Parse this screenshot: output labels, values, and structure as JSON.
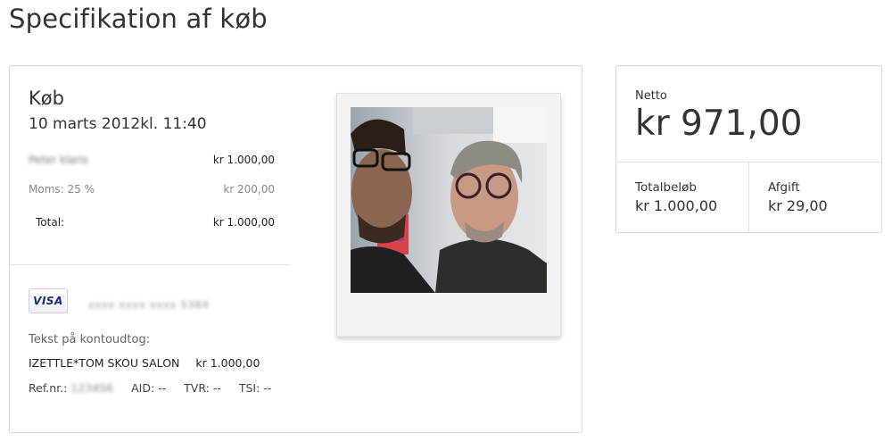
{
  "page": {
    "title": "Specifikation af køb"
  },
  "purchase": {
    "heading": "Køb",
    "date": "10 marts 2012kl. 11:40",
    "items": [
      {
        "name": "Peter klaris",
        "amount": "kr 1.000,00"
      }
    ],
    "vat": {
      "label": "Moms: 25 %",
      "amount": "kr 200,00"
    },
    "total": {
      "label": "Total:",
      "amount": "kr 1.000,00"
    },
    "payment": {
      "card_brand": "VISA",
      "card_number": "xxxx xxxx xxxx 5384",
      "statement_label": "Tekst på kontoudtog:",
      "statement_text": "IZETTLE*TOM SKOU SALON",
      "statement_amount": "kr 1.000,00",
      "ref_label": "Ref.nr.:",
      "ref_value": "123456",
      "aid": "AID: --",
      "tvr": "TVR: --",
      "tsi": "TSI: --"
    }
  },
  "summary": {
    "netto_label": "Netto",
    "netto_value": "kr 971,00",
    "total_label": "Totalbeløb",
    "total_value": "kr 1.000,00",
    "fee_label": "Afgift",
    "fee_value": "kr 29,00"
  }
}
